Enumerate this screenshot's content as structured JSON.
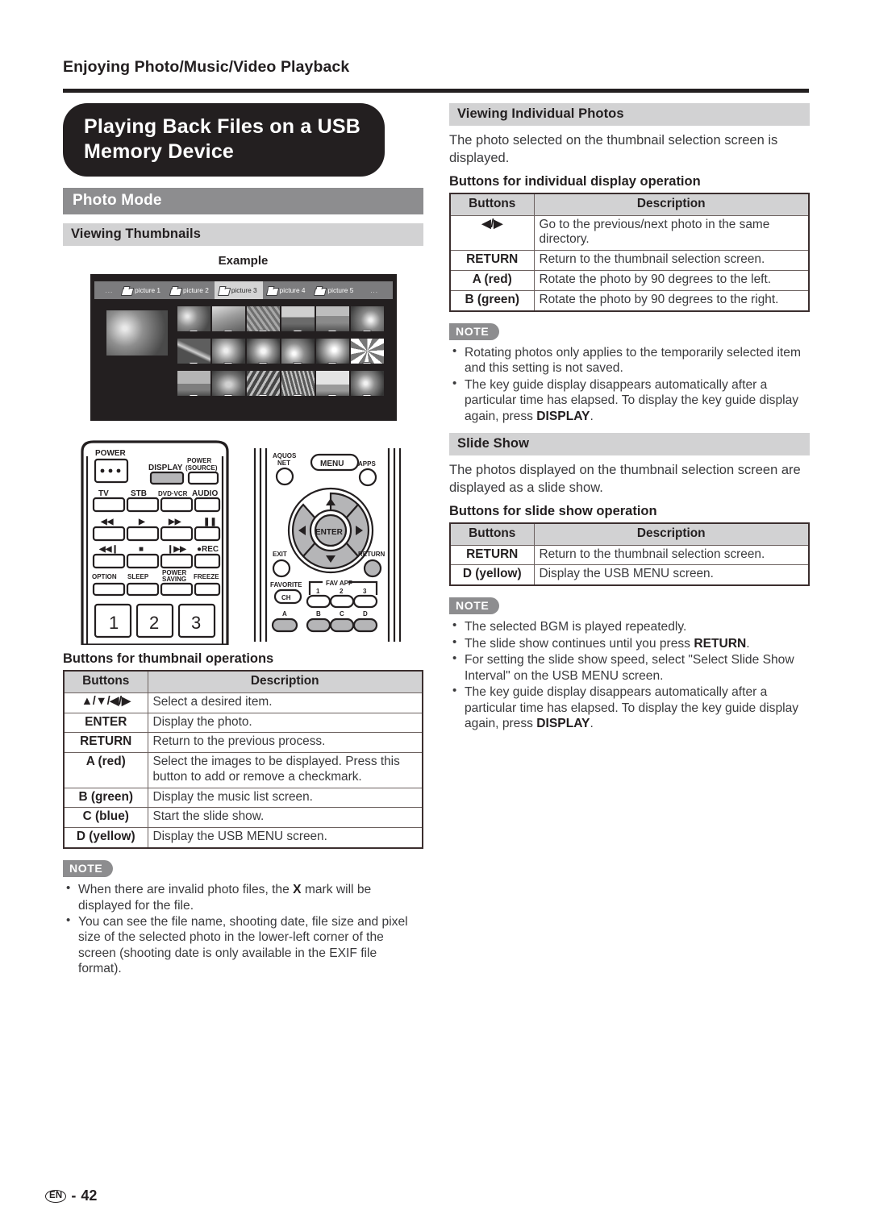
{
  "page": {
    "running_head": "Enjoying Photo/Music/Video Playback",
    "footer_lang": "EN",
    "footer_dash": "-",
    "footer_page": "42"
  },
  "chapter": {
    "title": "Playing Back Files on a USB Memory Device"
  },
  "left": {
    "section_bar": "Photo Mode",
    "subsection_bar": "Viewing Thumbnails",
    "example_caption": "Example",
    "tv_screen": {
      "ellipsis_left": "...",
      "ellipsis_right": "...",
      "folders": [
        {
          "label": "picture 1",
          "active": false
        },
        {
          "label": "picture 2",
          "active": false
        },
        {
          "label": "picture 3",
          "active": true
        },
        {
          "label": "picture 4",
          "active": false
        },
        {
          "label": "picture 5",
          "active": false
        }
      ]
    },
    "remote": {
      "power": "POWER",
      "display": "DISPLAY",
      "power_source_line1": "POWER",
      "power_source_line2": "(SOURCE)",
      "tv": "TV",
      "stb": "STB",
      "dvd_vcr": "DVD·VCR",
      "audio": "AUDIO",
      "rewind": "◀◀",
      "play": "▶",
      "fast_forward": "▶▶",
      "pause": "▐▐",
      "prev_track": "◀◀▕",
      "stop": "■",
      "next_track": "▏▶▶",
      "rec": "●REC",
      "option": "OPTION",
      "sleep": "SLEEP",
      "power_saving_line1": "POWER",
      "power_saving_line2": "SAVING",
      "freeze": "FREEZE",
      "num1": "1",
      "num2": "2",
      "num3": "3",
      "aquos_line1": "AQUOS",
      "aquos_line2": "NET",
      "menu": "MENU",
      "apps": "APPS",
      "enter": "ENTER",
      "exit": "EXIT",
      "return": "RETURN",
      "favorite": "FAVORITE",
      "ch": "CH",
      "fav_app": "FAV APP",
      "fav1": "1",
      "fav2": "2",
      "fav3": "3",
      "color_a": "A",
      "color_b": "B",
      "color_c": "C",
      "color_d": "D"
    },
    "table_heading": "Buttons for thumbnail operations",
    "table": {
      "columns": [
        "Buttons",
        "Description"
      ],
      "rows": [
        {
          "button": "▲/▼/◀/▶",
          "description": "Select a desired item."
        },
        {
          "button": "ENTER",
          "description": "Display the photo."
        },
        {
          "button": "RETURN",
          "description": "Return to the previous process."
        },
        {
          "button": "A (red)",
          "description": "Select the images to be displayed. Press this button to add or remove a checkmark."
        },
        {
          "button": "B (green)",
          "description": "Display the music list screen."
        },
        {
          "button": "C (blue)",
          "description": "Start the slide show."
        },
        {
          "button": "D (yellow)",
          "description": "Display the USB MENU screen."
        }
      ]
    },
    "note": {
      "badge": "NOTE",
      "items": [
        {
          "parts": [
            {
              "t": "When there are invalid photo files, the ",
              "b": false
            },
            {
              "t": "X",
              "b": true
            },
            {
              "t": " mark will be displayed for the file.",
              "b": false
            }
          ]
        },
        {
          "parts": [
            {
              "t": "You can see the file name, shooting date, file size and pixel size of the selected photo in the lower-left corner of the screen (shooting date is only available in the EXIF file format).",
              "b": false
            }
          ]
        }
      ]
    }
  },
  "right": {
    "section1_bar": "Viewing Individual Photos",
    "section1_body": "The photo selected on the thumbnail selection screen is displayed.",
    "section1_table_heading": "Buttons for individual display operation",
    "section1_table": {
      "columns": [
        "Buttons",
        "Description"
      ],
      "rows": [
        {
          "button": "◀/▶",
          "description": "Go to the previous/next photo in the same directory."
        },
        {
          "button": "RETURN",
          "description": "Return to the thumbnail selection screen."
        },
        {
          "button": "A (red)",
          "description": "Rotate the photo by 90 degrees to the left."
        },
        {
          "button": "B (green)",
          "description": "Rotate the photo by 90 degrees to the right."
        }
      ]
    },
    "note1": {
      "badge": "NOTE",
      "items": [
        {
          "parts": [
            {
              "t": "Rotating photos only applies to the temporarily selected item and this setting is not saved.",
              "b": false
            }
          ]
        },
        {
          "parts": [
            {
              "t": "The key guide display disappears automatically after a particular time has elapsed. To display the key guide display again, press ",
              "b": false
            },
            {
              "t": "DISPLAY",
              "b": true
            },
            {
              "t": ".",
              "b": false
            }
          ]
        }
      ]
    },
    "section2_bar": "Slide Show",
    "section2_body": "The photos displayed on the thumbnail selection screen are displayed as a slide show.",
    "section2_table_heading": "Buttons for slide show operation",
    "section2_table": {
      "columns": [
        "Buttons",
        "Description"
      ],
      "rows": [
        {
          "button": "RETURN",
          "description": "Return to the thumbnail selection screen."
        },
        {
          "button": "D (yellow)",
          "description": "Display the USB MENU screen."
        }
      ]
    },
    "note2": {
      "badge": "NOTE",
      "items": [
        {
          "parts": [
            {
              "t": "The selected BGM is played repeatedly.",
              "b": false
            }
          ]
        },
        {
          "parts": [
            {
              "t": "The slide show continues until you press ",
              "b": false
            },
            {
              "t": "RETURN",
              "b": true
            },
            {
              "t": ".",
              "b": false
            }
          ]
        },
        {
          "parts": [
            {
              "t": "For setting the slide show speed, select \"Select Slide Show Interval\" on the USB MENU screen.",
              "b": false
            }
          ]
        },
        {
          "parts": [
            {
              "t": "The key guide display disappears automatically after a particular time has elapsed. To display the key guide display again, press ",
              "b": false
            },
            {
              "t": "DISPLAY",
              "b": true
            },
            {
              "t": ".",
              "b": false
            }
          ]
        }
      ]
    }
  },
  "colors": {
    "ink": "#231f20",
    "bar_dark": "#8d8d8f",
    "bar_light": "#d2d2d3",
    "table_header": "#d2d2d3",
    "screen_bg": "#231f20"
  }
}
